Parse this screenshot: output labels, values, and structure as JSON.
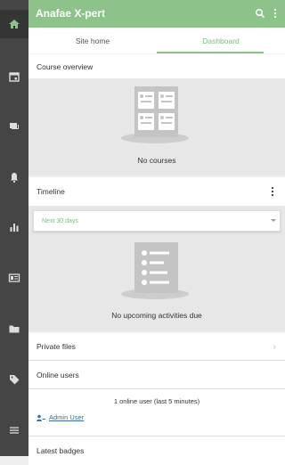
{
  "app": {
    "title": "Anafae X-pert"
  },
  "tabs": {
    "site_home": "Site home",
    "dashboard": "Dashboard"
  },
  "course_overview": {
    "heading": "Course overview",
    "empty": "No courses"
  },
  "timeline": {
    "heading": "Timeline",
    "filter_value": "Next 30 days",
    "empty": "No upcoming activities due"
  },
  "private_files": {
    "heading": "Private files"
  },
  "online_users": {
    "heading": "Online users",
    "count_text": "1 online user (last 5 minutes)",
    "user": "Admin User"
  },
  "latest_badges": {
    "heading": "Latest badges"
  },
  "rail_icons": [
    "home-icon",
    "calendar-icon",
    "messages-icon",
    "notifications-icon",
    "grades-icon",
    "badge-card-icon",
    "folder-icon",
    "tag-icon",
    "menu-icon"
  ],
  "colors": {
    "appbar": "#8dc28a",
    "rail": "#454545",
    "accent_text": "#7fbb7c",
    "link": "#3a6ea5"
  }
}
